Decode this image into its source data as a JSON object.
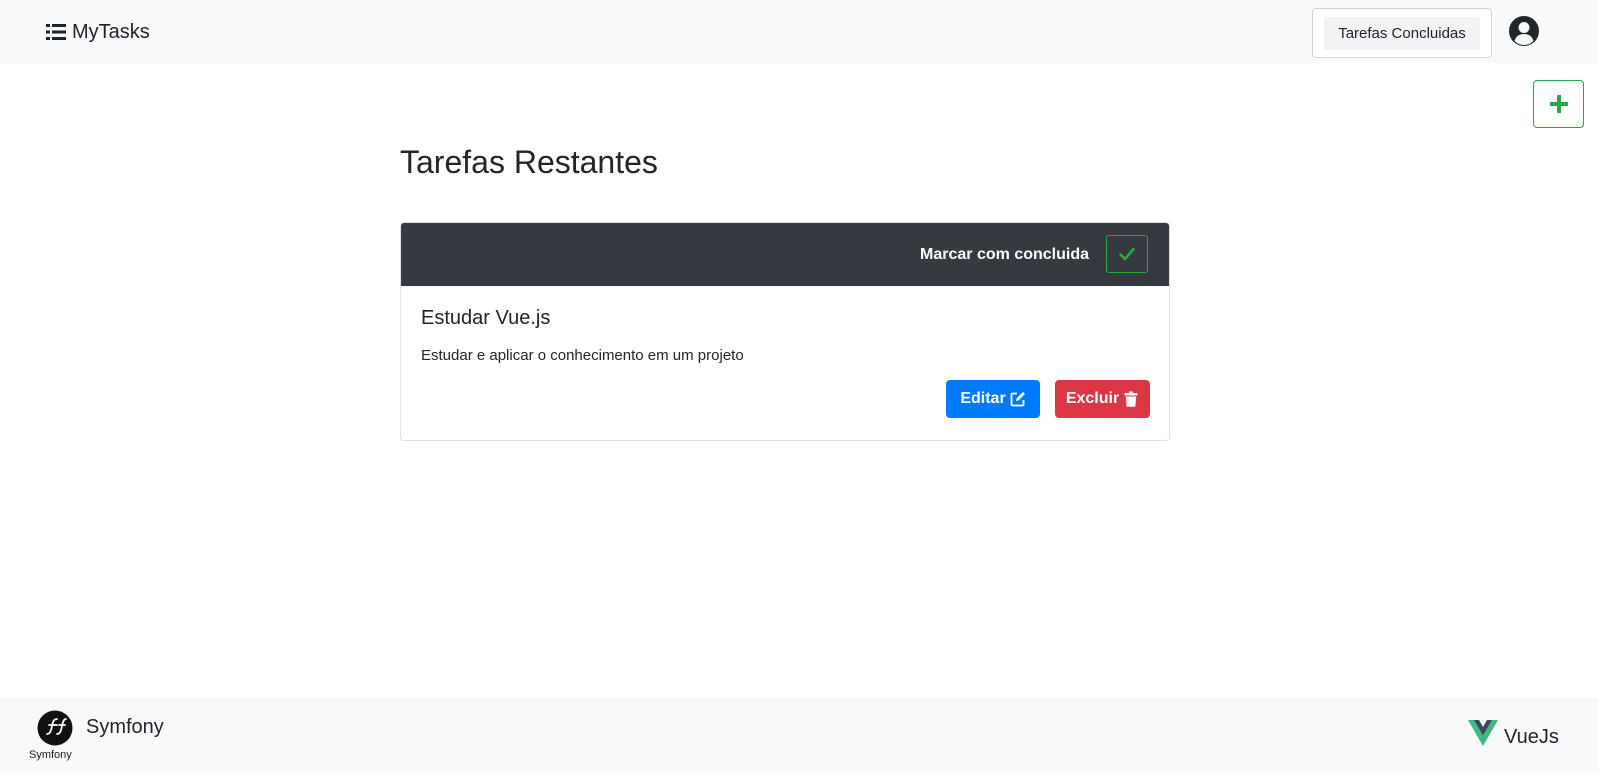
{
  "navbar": {
    "brand": "MyTasks",
    "brand_icon": "list-icon",
    "completed_link": "Tarefas Concluidas",
    "user_icon": "user-circle-icon"
  },
  "add_button_icon": "plus-icon",
  "main": {
    "title": "Tarefas Restantes",
    "task": {
      "mark_label": "Marcar com concluida",
      "title": "Estudar Vue.js",
      "description": "Estudar e aplicar o conhecimento em um projeto",
      "edit_label": "Editar",
      "delete_label": "Excluir"
    }
  },
  "footer": {
    "symfony_caption": "Symfony",
    "symfony_name": "Symfony",
    "vue_name": "VueJs"
  },
  "colors": {
    "success": "#28a745",
    "primary": "#007bff",
    "danger": "#dc3545",
    "dark": "#343a40",
    "light": "#f8f9fa"
  }
}
